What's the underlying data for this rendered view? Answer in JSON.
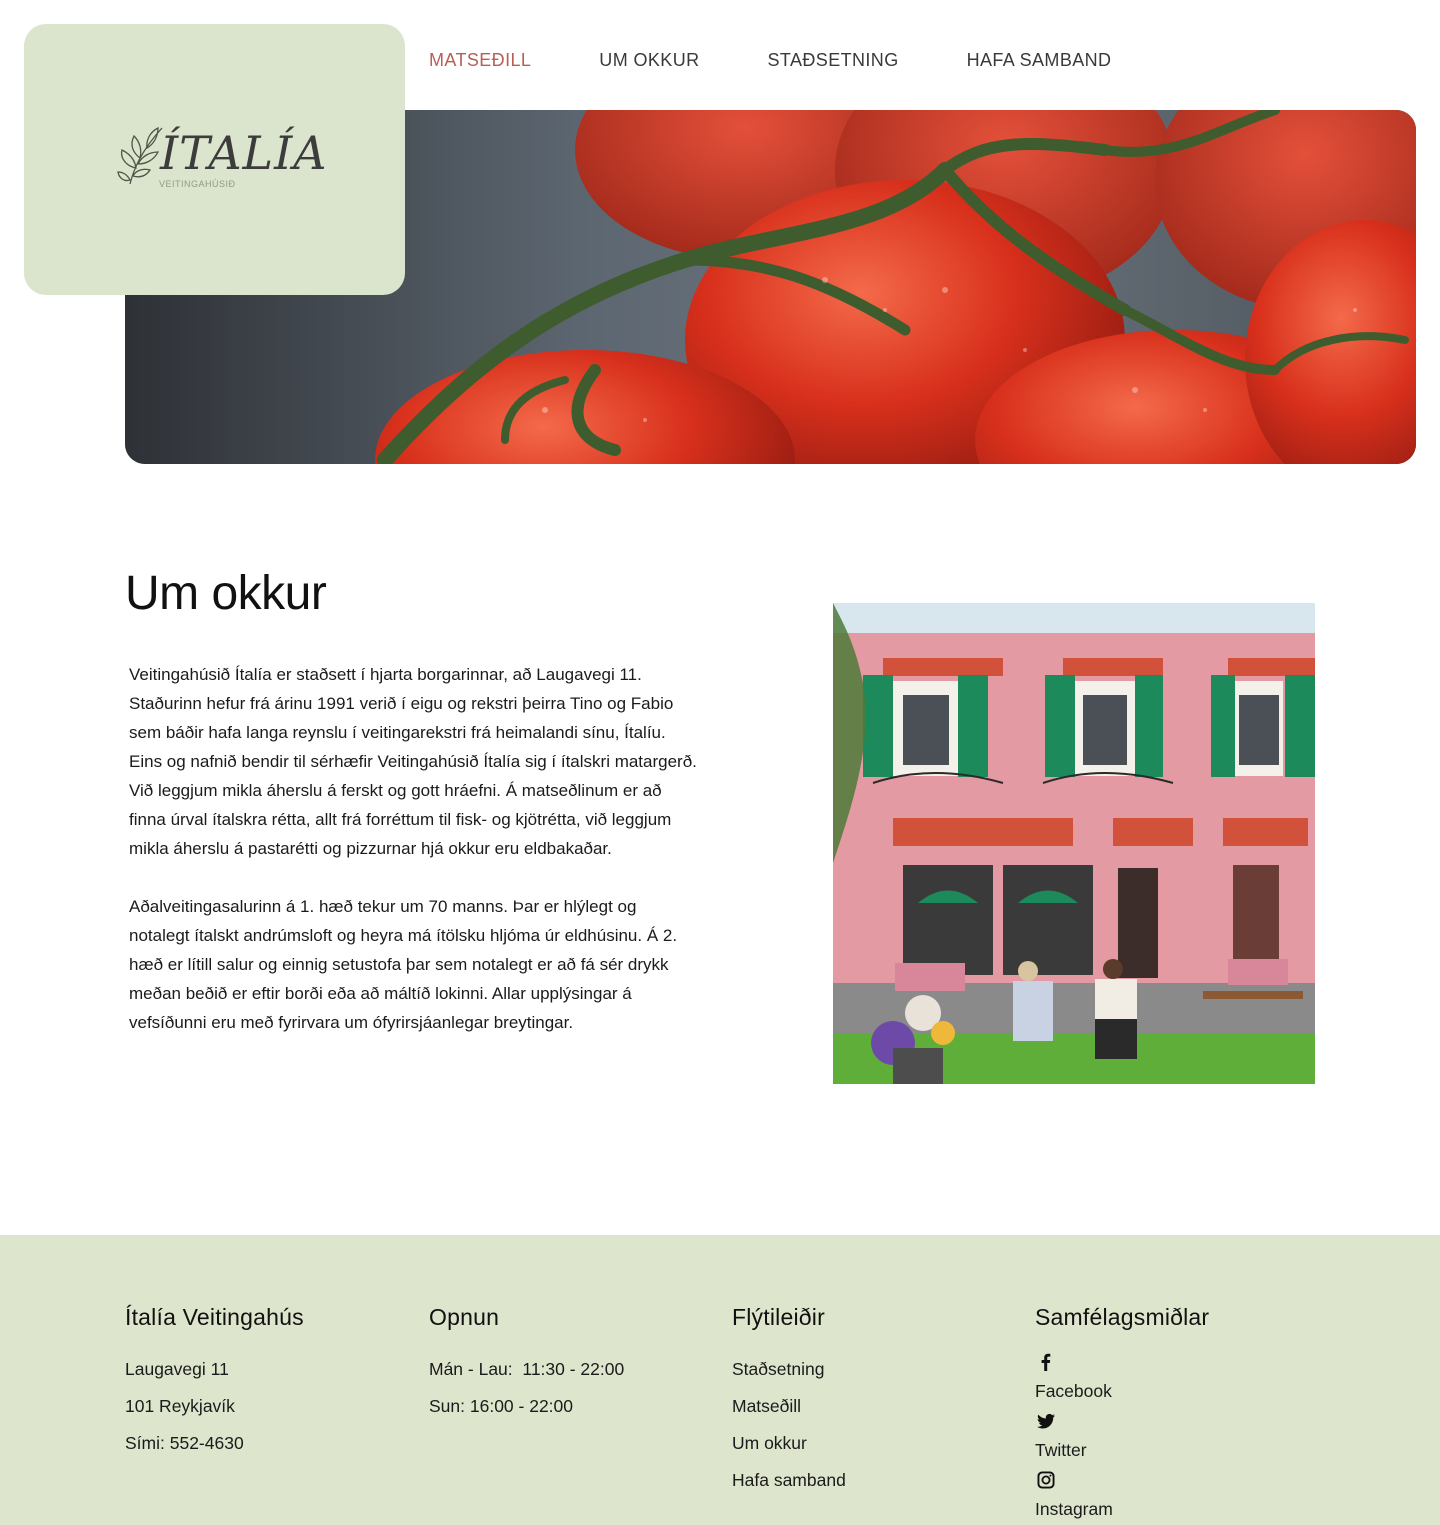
{
  "brand": {
    "name": "ÍTALÍA",
    "subtitle": "VEITINGAHÚSIÐ"
  },
  "nav": {
    "items": [
      {
        "label": "MATSEÐILL",
        "active": true
      },
      {
        "label": "UM OKKUR",
        "active": false
      },
      {
        "label": "STAÐSETNING",
        "active": false
      },
      {
        "label": "HAFA SAMBAND",
        "active": false
      }
    ]
  },
  "about": {
    "title": "Um okkur",
    "paragraphs": [
      "Veitingahúsið Ítalía er staðsett í hjarta borgarinnar, að Laugavegi 11. Staðurinn hefur frá árinu 1991 verið í eigu og rekstri þeirra Tino og Fabio sem báðir hafa langa reynslu í veitingarekstri frá heimalandi sínu, Ítalíu. Eins og nafnið bendir til sérhæfir Veitingahúsið Ítalía sig í ítalskri matargerð. Við leggjum mikla áherslu á ferskt og gott hráefni. Á matseðlinum er að finna úrval ítalskra rétta, allt frá forréttum til fisk- og kjötrétta, við leggjum mikla áherslu á pastarétti og pizzurnar hjá okkur eru eldbakaðar.",
      "Aðalveitingasalurinn á 1. hæð tekur um 70 manns. Þar er hlýlegt og notalegt ítalskt andrúmsloft og heyra má ítölsku hljóma úr eldhúsinu. Á 2. hæð er lítill salur og einnig setustofa þar sem notalegt er að fá sér drykk meðan beðið er eftir borði eða að máltíð lokinni. Allar upplýsingar á vefsíðunni eru með fyrirvara um ófyrirsjáanlegar breytingar."
    ]
  },
  "footer": {
    "contact": {
      "title": "Ítalía Veitingahús",
      "address": "Laugavegi 11",
      "city": "101 Reykjavík",
      "phone": "Sími: 552-4630"
    },
    "hours": {
      "title": "Opnun",
      "weekdays": "Mán - Lau:  11:30 - 22:00",
      "sunday": "Sun: 16:00 - 22:00"
    },
    "shortcuts": {
      "title": "Flýtileiðir",
      "links": [
        "Staðsetning",
        "Matseðill",
        "Um okkur",
        "Hafa samband"
      ]
    },
    "social": {
      "title": "Samfélagsmiðlar",
      "links": [
        {
          "label": "Facebook",
          "icon": "facebook-icon"
        },
        {
          "label": "Twitter",
          "icon": "twitter-icon"
        },
        {
          "label": "Instagram",
          "icon": "instagram-icon"
        }
      ]
    }
  },
  "colors": {
    "accent_green": "#dbe4cc",
    "nav_active": "#b85e56",
    "nav_text": "#3a3a3a"
  }
}
